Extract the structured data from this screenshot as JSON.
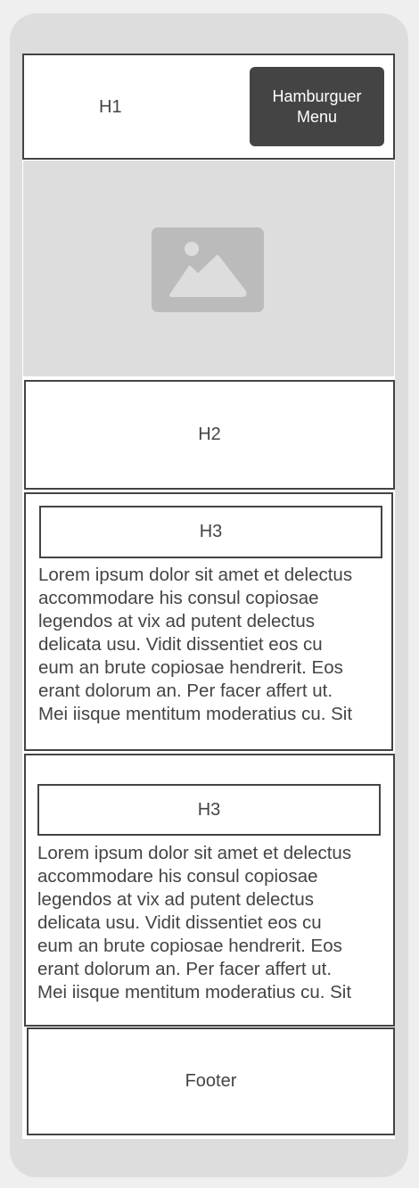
{
  "header": {
    "title": "H1",
    "menu_button": [
      "Hamburguer",
      "Menu"
    ]
  },
  "hero": {
    "icon": "image-placeholder-icon"
  },
  "section_heading": "H2",
  "articles": [
    {
      "heading": "H3",
      "lines": [
        "Lorem ipsum dolor sit amet et delectus",
        "accommodare his consul copiosae",
        "legendos at vix ad putent delectus",
        "delicata usu. Vidit dissentiet eos cu",
        "eum an brute copiosae hendrerit. Eos",
        "erant dolorum an. Per facer affert ut.",
        "Mei iisque mentitum moderatius cu. Sit"
      ]
    },
    {
      "heading": "H3",
      "lines": [
        "Lorem ipsum dolor sit amet et delectus",
        "accommodare his consul copiosae",
        "legendos at vix ad putent delectus",
        "delicata usu. Vidit dissentiet eos cu",
        "eum an brute copiosae hendrerit. Eos",
        "erant dolorum an. Per facer affert ut.",
        "Mei iisque mentitum moderatius cu. Sit"
      ]
    }
  ],
  "footer": {
    "label": "Footer"
  },
  "colors": {
    "frame": "#dddddd",
    "border": "#444444",
    "button": "#444444",
    "placeholder": "#bbbbbb"
  }
}
